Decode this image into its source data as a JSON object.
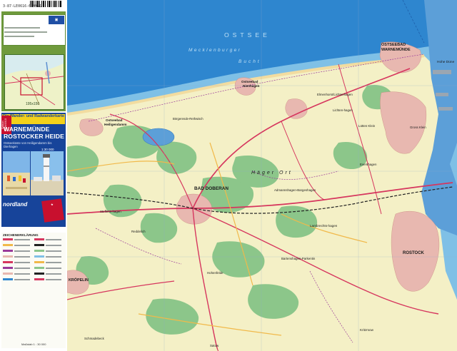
{
  "cover": {
    "isbn_code": "3-87-LE0616-6 9951",
    "promo_ribbon": "Die Wander- und Radwanderkarte",
    "promo_corner": "Saison 2009/2010",
    "title_line1": "WARNEMÜNDE",
    "title_line2": "ROSTOCKER HEIDE",
    "subtitle": "Ostseeküste von Heiligendamm bis Dierhagen",
    "scale": "1:30 000",
    "publisher": "nordland",
    "legend_title": "ZEICHENERKLÄRUNG",
    "legend_caption": "Maßstab 1 : 30 000"
  },
  "map": {
    "sea_name": "OSTSEE",
    "bay_line1": "Mecklenburger",
    "bay_line2": "Bucht",
    "labels": {
      "warnemuende1": "OSTSEEBAD",
      "warnemuende2": "WARNEMÜNDE",
      "hohe_duene": "Hohe Düne",
      "heiligendamm1": "Ostseebad",
      "heiligendamm2": "Heiligendamm",
      "nienhagen1": "Ostseebad",
      "nienhagen2": "Nienhagen",
      "elmenhorst": "Elmenhorst/Lichtenhagen",
      "lichtenhagen": "Lichten-hagen",
      "lutten_klein": "Lütten Klein",
      "gross_klein": "Gross Klein",
      "boergerende": "Börgerende-Rethwisch",
      "bad_doberan": "BAD DOBERAN",
      "haeger_ort": "Häger Ort",
      "admannshagen": "Admannshagen-Bargeshagen",
      "evershagen": "Evershagen",
      "steffenshagen": "Steffens-hagen",
      "reddelich": "Reddelich",
      "lambrechtshagen": "Lambrechts-hagen",
      "bartenshagen": "Bartenshagen-Parkentin",
      "kroepelin": "KRÖPELIN",
      "hohenfelde": "Hohenfelde",
      "kritzmow": "Kritzmow",
      "schmadebeck": "Schmadebeck",
      "satow": "Satow",
      "rostock": "ROSTOCK"
    }
  },
  "colors": {
    "sea_deep": "#2e86cf",
    "sea_shallow": "#7fc0e6",
    "land": "#f4f0c6",
    "forest": "#8cc68a",
    "town": "#e8b8b0",
    "road": "#d6365e",
    "cover_green": "#6f9a3c",
    "cover_blue": "#17449a",
    "cover_red": "#c8102e"
  }
}
